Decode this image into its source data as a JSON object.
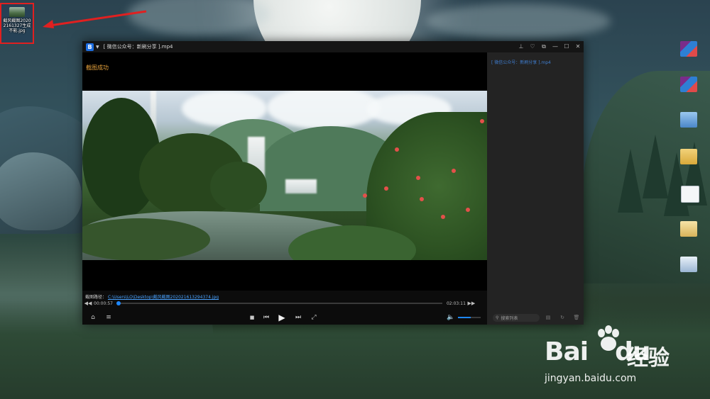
{
  "desktop": {
    "screenshot_icon_label": "截风截图20202161327生成不能.jpg",
    "icons": [
      {
        "label": "",
        "type": "rar"
      },
      {
        "label": "",
        "type": "rar"
      },
      {
        "label": "",
        "type": "pc"
      },
      {
        "label": "",
        "type": "folder"
      },
      {
        "label": "",
        "type": "doc"
      },
      {
        "label": "",
        "type": "folder"
      },
      {
        "label": "",
        "type": "img"
      }
    ]
  },
  "player": {
    "window_title": "[ 微信公众号：新刷分享 ].mp4",
    "window_controls": {
      "pin": "⊥",
      "skin": "♡",
      "mini": "⧉",
      "minimize": "—",
      "maximize": "☐",
      "close": "✕"
    },
    "screenshot_status": "截图成功",
    "screenshot_path_label": "截图路径：",
    "screenshot_path_link": "C:\\Users\\LO\\Desktop\\截风截图20202161329437​4.jpg",
    "current_time": "00:00:57",
    "total_time": "02:03:11",
    "progress": 0.005,
    "volume": 0.55,
    "playlist_item": "[ 微信公众号：新刷分享 ].mp4",
    "playlist_search_placeholder": "搜索列表"
  },
  "watermark": {
    "brand_prefix": "Bai",
    "brand_suffix": "du",
    "brand_cn": "经验",
    "url": "jingyan.baidu.com"
  },
  "colors": {
    "accent_blue": "#1e88ff",
    "status_orange": "#e6a23c",
    "annotation_red": "#e02020"
  }
}
